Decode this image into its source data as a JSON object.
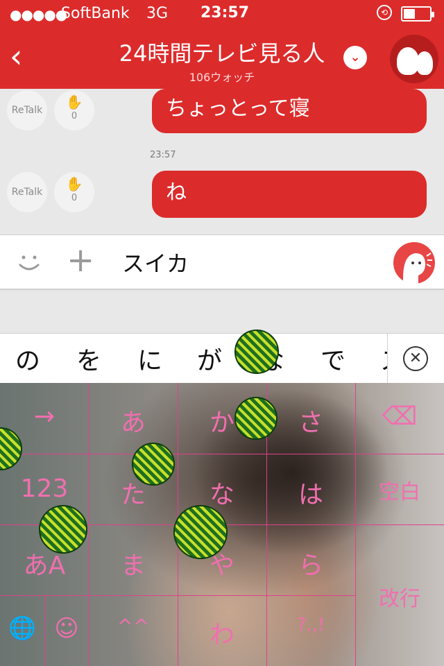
{
  "status_bar": {
    "signal": "●●●●●",
    "carrier": "SoftBank",
    "network": "3G",
    "time": "23:57"
  },
  "header": {
    "back_glyph": "‹",
    "title": "24時間テレビ見る人",
    "subtitle": "106ウォッチ",
    "dropdown_glyph": "⌄"
  },
  "messages": [
    {
      "text": "ちょっとって寝",
      "retalk_label": "ReTalk",
      "clap_count": "0"
    },
    {
      "text": "ね",
      "retalk_label": "ReTalk",
      "clap_count": "0",
      "timestamp": "23:57"
    }
  ],
  "input_bar": {
    "text": "スイカ"
  },
  "candidates": [
    "の",
    "を",
    "に",
    "が",
    "な",
    "で",
    "ス"
  ],
  "keyboard": {
    "rows": [
      [
        "→",
        "あ",
        "か",
        "さ",
        "⌫"
      ],
      [
        "123",
        "た",
        "な",
        "は",
        "空白"
      ],
      [
        "あA",
        "ま",
        "や",
        "ら",
        "改行"
      ],
      [
        "🌐",
        "☺",
        "^^",
        "わ",
        "?.,!"
      ]
    ]
  },
  "colors": {
    "brand_red": "#dc2b2b",
    "key_pink": "#f06fb0"
  }
}
